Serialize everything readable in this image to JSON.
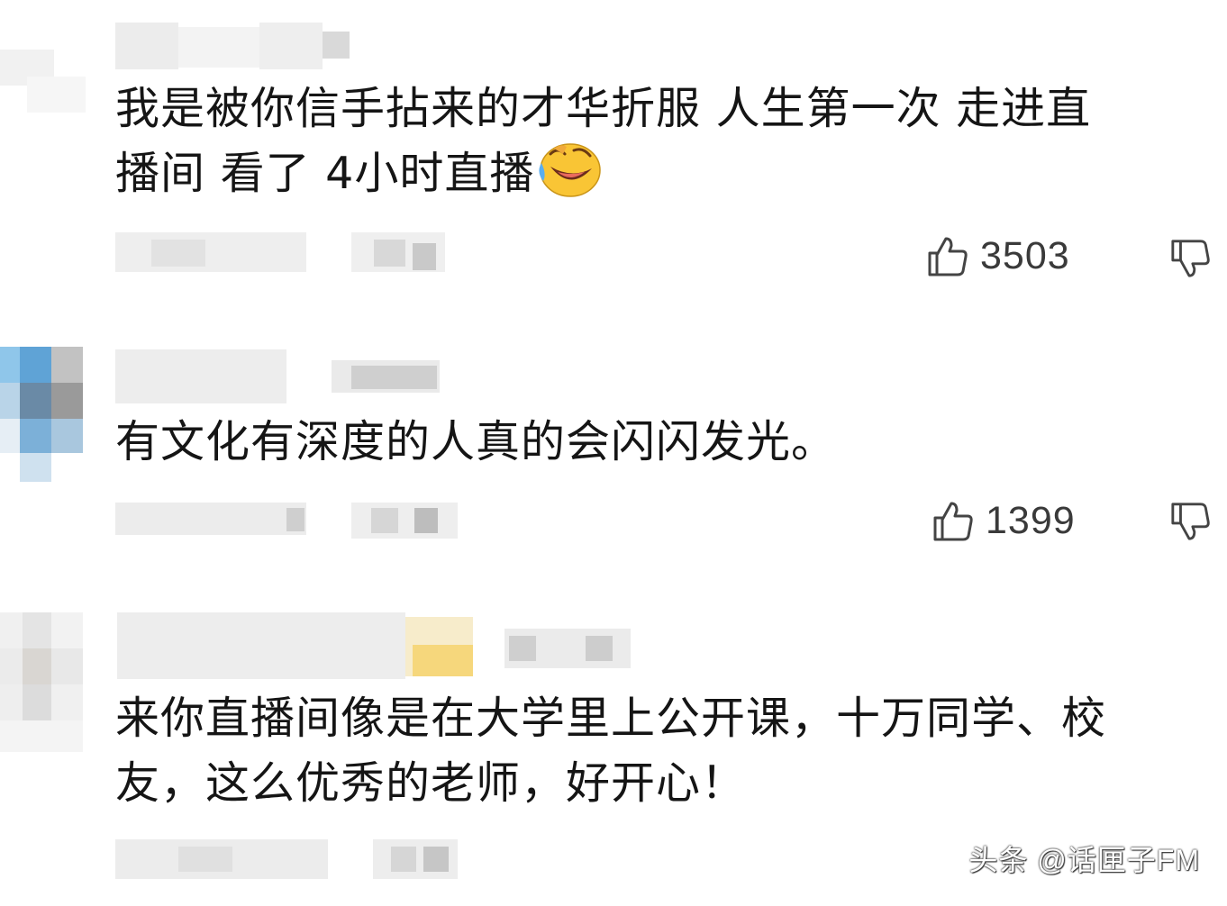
{
  "comments": [
    {
      "text": "我是被你信手拈来的才华折服 人生第一次 走进直播间 看了4小时直播",
      "line1": "我是被你信手拈来的才华折服 人生第一次 走进直",
      "line2": "播间 看了 4小时直播",
      "has_emoji": true,
      "emoji": "rolling-on-floor-laughing-emoji",
      "likes": "3503"
    },
    {
      "text": "有文化有深度的人真的会闪闪发光。",
      "line1": "有文化有深度的人真的会闪闪发光。",
      "likes": "1399"
    },
    {
      "text": "来你直播间像是在大学里上公开课，十万同学、校友，这么优秀的老师，好开心！",
      "line1": "来你直播间像是在大学里上公开课，十万同学、校",
      "line2": "友，这么优秀的老师，好开心！"
    }
  ],
  "watermark": "头条 @话匣子FM",
  "icons": {
    "like": "thumbs-up-icon",
    "dislike": "thumbs-down-icon"
  },
  "colors": {
    "text": "#151515",
    "muted": "#3a3a3a",
    "mosaic_light": "#eeeeee",
    "mosaic_mid": "#d4d4d4"
  }
}
